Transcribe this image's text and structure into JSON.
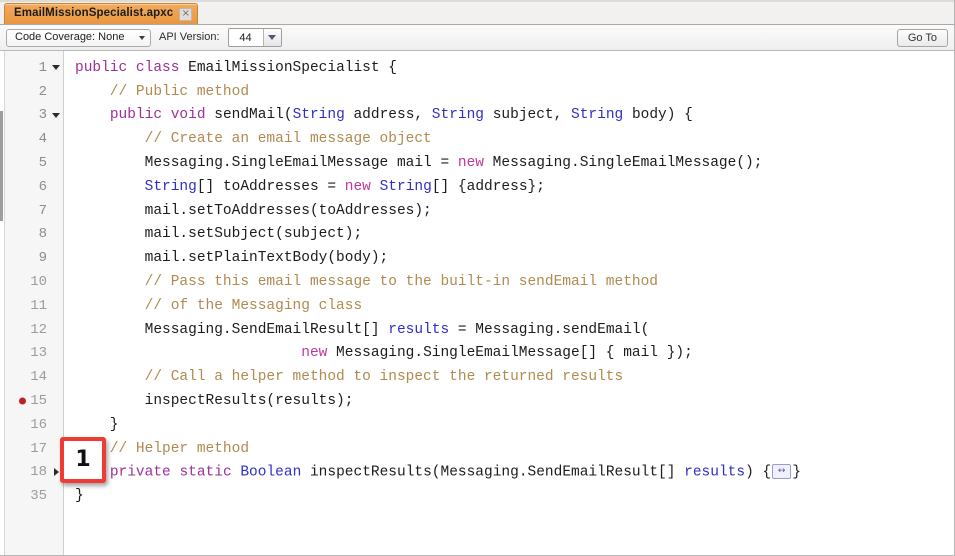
{
  "tab": {
    "title": "EmailMissionSpecialist.apxc",
    "close_label": "×"
  },
  "toolbar": {
    "code_coverage_label": "Code Coverage: None",
    "api_version_label": "API Version:",
    "api_version_value": "44",
    "goto_label": "Go To"
  },
  "annotation": {
    "number": "1"
  },
  "colors": {
    "tab_bg": "#eda04d",
    "keyword": "#9c2f9c",
    "keyword_new": "#c0399a",
    "type": "#2f2fc8",
    "comment": "#b08a50",
    "breakpoint": "#bb2222",
    "annotation_border": "#ee3b33",
    "gutter_bg": "#f6f6f6"
  },
  "editor": {
    "lines": [
      {
        "number": "1",
        "fold": "down",
        "breakpoint": false,
        "tokens": [
          {
            "t": "public",
            "c": "kw"
          },
          {
            "t": " ",
            "c": "plain"
          },
          {
            "t": "class",
            "c": "kw"
          },
          {
            "t": " EmailMissionSpecialist {",
            "c": "plain"
          }
        ]
      },
      {
        "number": "2",
        "fold": "",
        "breakpoint": false,
        "tokens": [
          {
            "t": "    // Public method",
            "c": "cmt"
          }
        ]
      },
      {
        "number": "3",
        "fold": "down",
        "breakpoint": false,
        "tokens": [
          {
            "t": "    ",
            "c": "plain"
          },
          {
            "t": "public",
            "c": "kw"
          },
          {
            "t": " ",
            "c": "plain"
          },
          {
            "t": "void",
            "c": "kw"
          },
          {
            "t": " sendMail(",
            "c": "plain"
          },
          {
            "t": "String",
            "c": "type"
          },
          {
            "t": " address, ",
            "c": "plain"
          },
          {
            "t": "String",
            "c": "type"
          },
          {
            "t": " subject, ",
            "c": "plain"
          },
          {
            "t": "String",
            "c": "type"
          },
          {
            "t": " body) {",
            "c": "plain"
          }
        ]
      },
      {
        "number": "4",
        "fold": "",
        "breakpoint": false,
        "tokens": [
          {
            "t": "        // Create an email message object",
            "c": "cmt"
          }
        ]
      },
      {
        "number": "5",
        "fold": "",
        "breakpoint": false,
        "tokens": [
          {
            "t": "        Messaging.SingleEmailMessage mail = ",
            "c": "plain"
          },
          {
            "t": "new",
            "c": "kw2"
          },
          {
            "t": " Messaging.SingleEmailMessage();",
            "c": "plain"
          }
        ]
      },
      {
        "number": "6",
        "fold": "",
        "breakpoint": false,
        "tokens": [
          {
            "t": "        ",
            "c": "plain"
          },
          {
            "t": "String",
            "c": "type"
          },
          {
            "t": "[] toAddresses = ",
            "c": "plain"
          },
          {
            "t": "new",
            "c": "kw2"
          },
          {
            "t": " ",
            "c": "plain"
          },
          {
            "t": "String",
            "c": "type"
          },
          {
            "t": "[] {address};",
            "c": "plain"
          }
        ]
      },
      {
        "number": "7",
        "fold": "",
        "breakpoint": false,
        "tokens": [
          {
            "t": "        mail.setToAddresses(toAddresses);",
            "c": "plain"
          }
        ]
      },
      {
        "number": "8",
        "fold": "",
        "breakpoint": false,
        "tokens": [
          {
            "t": "        mail.setSubject(subject);",
            "c": "plain"
          }
        ]
      },
      {
        "number": "9",
        "fold": "",
        "breakpoint": false,
        "tokens": [
          {
            "t": "        mail.setPlainTextBody(body);",
            "c": "plain"
          }
        ]
      },
      {
        "number": "10",
        "fold": "",
        "breakpoint": false,
        "tokens": [
          {
            "t": "        // Pass this email message to the built-in sendEmail method",
            "c": "cmt"
          }
        ]
      },
      {
        "number": "11",
        "fold": "",
        "breakpoint": false,
        "tokens": [
          {
            "t": "        // of the Messaging class",
            "c": "cmt"
          }
        ]
      },
      {
        "number": "12",
        "fold": "",
        "breakpoint": false,
        "tokens": [
          {
            "t": "        Messaging.SendEmailResult[] ",
            "c": "plain"
          },
          {
            "t": "results",
            "c": "type"
          },
          {
            "t": " = Messaging.sendEmail(",
            "c": "plain"
          }
        ]
      },
      {
        "number": "13",
        "fold": "",
        "breakpoint": false,
        "tokens": [
          {
            "t": "                          ",
            "c": "plain"
          },
          {
            "t": "new",
            "c": "kw2"
          },
          {
            "t": " Messaging.SingleEmailMessage[] { mail });",
            "c": "plain"
          }
        ]
      },
      {
        "number": "14",
        "fold": "",
        "breakpoint": false,
        "tokens": [
          {
            "t": "        // Call a helper method to inspect the returned results",
            "c": "cmt"
          }
        ]
      },
      {
        "number": "15",
        "fold": "",
        "breakpoint": true,
        "tokens": [
          {
            "t": "        inspectResults(results);",
            "c": "plain"
          }
        ]
      },
      {
        "number": "16",
        "fold": "",
        "breakpoint": false,
        "tokens": [
          {
            "t": "    }",
            "c": "plain"
          }
        ]
      },
      {
        "number": "17",
        "fold": "",
        "breakpoint": false,
        "tokens": [
          {
            "t": "    // Helper method",
            "c": "cmt"
          }
        ]
      },
      {
        "number": "18",
        "fold": "right",
        "breakpoint": false,
        "tokens": [
          {
            "t": "    ",
            "c": "plain"
          },
          {
            "t": "private",
            "c": "kw"
          },
          {
            "t": " ",
            "c": "plain"
          },
          {
            "t": "static",
            "c": "kw"
          },
          {
            "t": " ",
            "c": "plain"
          },
          {
            "t": "Boolean",
            "c": "type"
          },
          {
            "t": " inspectResults(Messaging.SendEmailResult[] ",
            "c": "plain"
          },
          {
            "t": "results",
            "c": "type"
          },
          {
            "t": ") {",
            "c": "plain"
          },
          {
            "t": "↔",
            "c": "foldbadge"
          },
          {
            "t": "}",
            "c": "plain"
          }
        ]
      },
      {
        "number": "35",
        "fold": "",
        "breakpoint": false,
        "tokens": [
          {
            "t": "}",
            "c": "plain"
          }
        ]
      }
    ]
  }
}
